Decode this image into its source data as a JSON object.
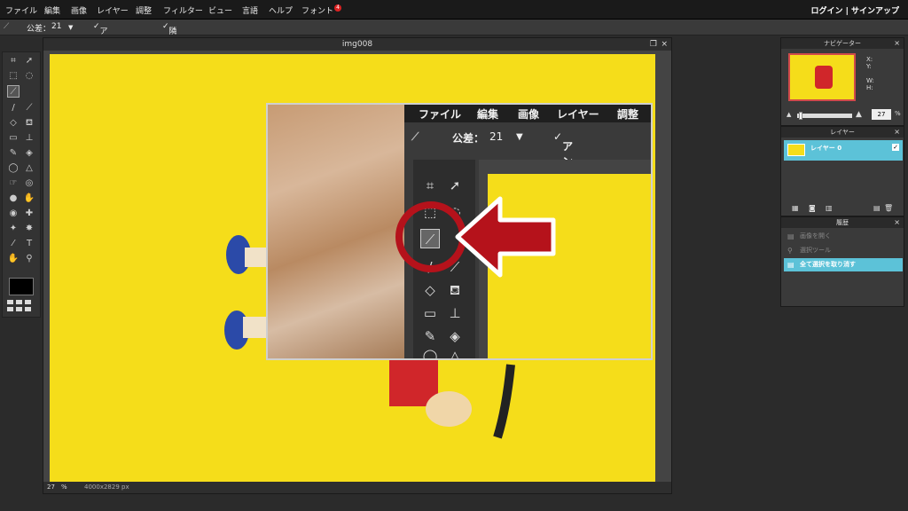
{
  "menubar": {
    "items": [
      "ファイル",
      "編集",
      "画像",
      "レイヤー",
      "調整",
      "フィルター",
      "ビュー",
      "言語",
      "ヘルプ",
      "フォント"
    ],
    "font_badge": "4",
    "login": "ログイン | サインアップ"
  },
  "options": {
    "tolerance_label": "公差：",
    "tolerance_value": "21",
    "antialias_label": "アンチエイリアス",
    "contiguous_label": "隣接部"
  },
  "canvas": {
    "title": "img008",
    "zoom": "27",
    "zoom_unit": "%",
    "size": "4000x2829 px"
  },
  "inset": {
    "menu": [
      "ファイル",
      "編集",
      "画像",
      "レイヤー",
      "調整"
    ],
    "tolerance_label": "公差：",
    "tolerance_value": "21",
    "antialias_label": "アンチエイリアス"
  },
  "navigator": {
    "title": "ナビゲーター",
    "x_label": "X:",
    "y_label": "Y:",
    "w_label": "W:",
    "h_label": "H:",
    "zoom_value": "27",
    "zoom_unit": "%"
  },
  "layers": {
    "title": "レイヤー",
    "items": [
      {
        "name": "レイヤー 0"
      }
    ]
  },
  "history": {
    "title": "履歴",
    "items": [
      {
        "label": "画像を開く"
      },
      {
        "label": "選択ツール"
      },
      {
        "label": "全て選択を取り消す"
      }
    ]
  },
  "colors": {
    "canvas": "#f5dd1a",
    "highlight": "#5cc2d8",
    "arrow": "#b5121b"
  }
}
